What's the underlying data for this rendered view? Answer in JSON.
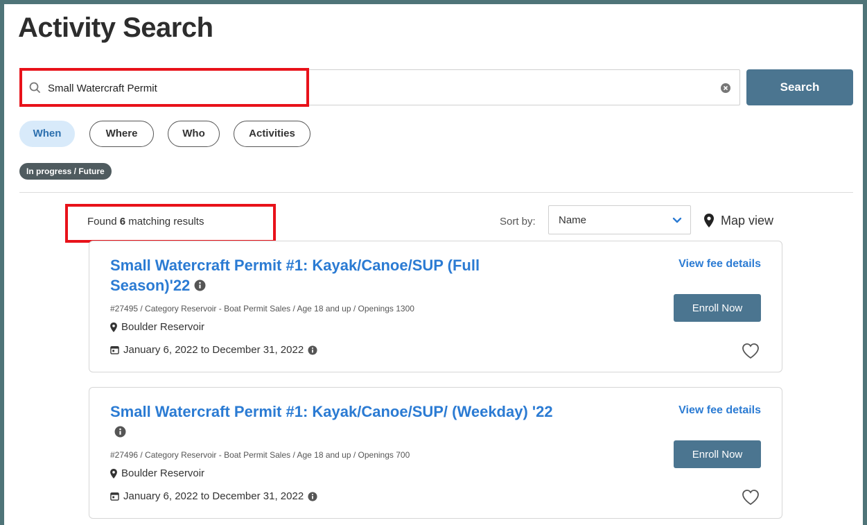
{
  "page": {
    "title": "Activity Search"
  },
  "search": {
    "value": "Small Watercraft Permit",
    "button_label": "Search"
  },
  "filters": [
    {
      "label": "When",
      "active": true
    },
    {
      "label": "Where",
      "active": false
    },
    {
      "label": "Who",
      "active": false
    },
    {
      "label": "Activities",
      "active": false
    }
  ],
  "status_chip": "In progress / Future",
  "results": {
    "prefix": "Found",
    "count": "6",
    "suffix": "matching results"
  },
  "sort": {
    "label": "Sort by:",
    "value": "Name"
  },
  "map_view_label": "Map view",
  "activities": [
    {
      "title": "Small Watercraft Permit #1: Kayak/Canoe/SUP (Full Season)'22",
      "meta": "#27495 / Category Reservoir - Boat Permit Sales / Age 18 and up / Openings 1300",
      "location": "Boulder Reservoir",
      "dates": "January 6, 2022 to December 31, 2022",
      "fee_link": "View fee details",
      "enroll_label": "Enroll Now"
    },
    {
      "title": "Small Watercraft Permit #1: Kayak/Canoe/SUP/ (Weekday) '22",
      "meta": "#27496 / Category Reservoir - Boat Permit Sales / Age 18 and up / Openings 700",
      "location": "Boulder Reservoir",
      "dates": "January 6, 2022 to December 31, 2022",
      "fee_link": "View fee details",
      "enroll_label": "Enroll Now"
    }
  ],
  "colors": {
    "frame": "#4f7478",
    "primary_button": "#4b7590",
    "link": "#2b7bd3",
    "active_pill_bg": "#d8eafa",
    "highlight": "#e8121a"
  }
}
